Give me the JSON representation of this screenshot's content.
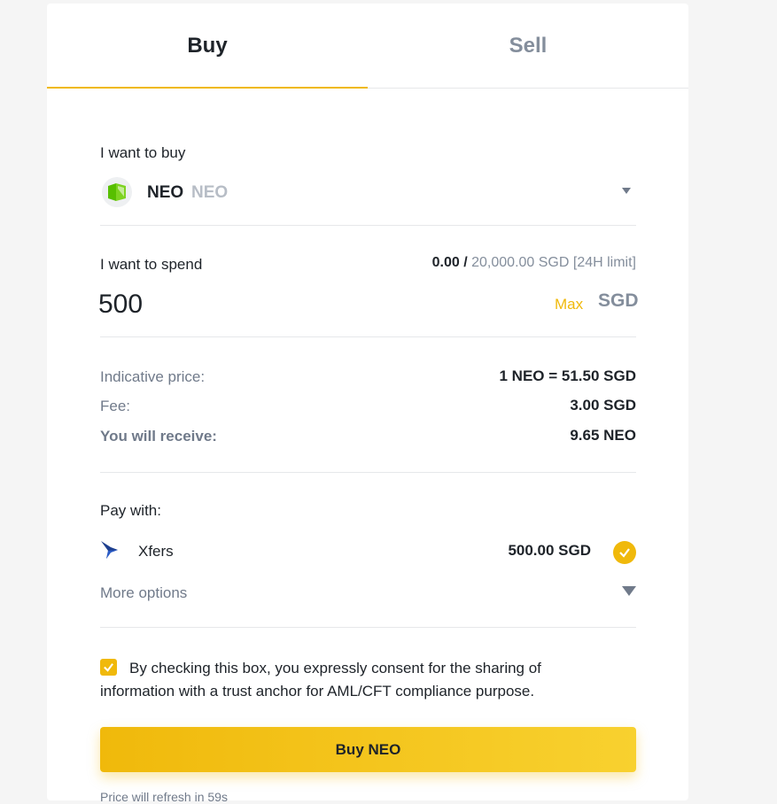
{
  "tabs": {
    "buy": "Buy",
    "sell": "Sell"
  },
  "coin": {
    "label": "I want to buy",
    "name": "NEO",
    "code": "NEO"
  },
  "spend": {
    "label": "I want to spend",
    "used": "0.00 /",
    "limit": "20,000.00 SGD [24H limit]",
    "value": "500",
    "max": "Max",
    "currency": "SGD"
  },
  "summary": {
    "price_label": "Indicative price:",
    "price_value": "1 NEO = 51.50 SGD",
    "fee_label": "Fee:",
    "fee_value": "3.00 SGD",
    "receive_label": "You will receive:",
    "receive_value": "9.65 NEO"
  },
  "payment": {
    "label": "Pay with:",
    "method": "Xfers",
    "amount": "500.00 SGD",
    "more": "More options"
  },
  "consent": {
    "text": "By checking this box, you expressly consent for the sharing of information with a trust anchor for AML/CFT compliance purpose.",
    "checked": true
  },
  "action": {
    "buy_button": "Buy NEO"
  },
  "footer": {
    "note": "Price will refresh in 59s"
  },
  "icons": {
    "coin": "neo-logo-icon",
    "payment": "xfers-logo-icon",
    "selected": "check-icon",
    "dropdown": "chevron-down-icon"
  },
  "colors": {
    "accent": "#f0b90b",
    "text": "#1e2329",
    "muted": "#848e9c",
    "border": "#e6e8ea"
  }
}
